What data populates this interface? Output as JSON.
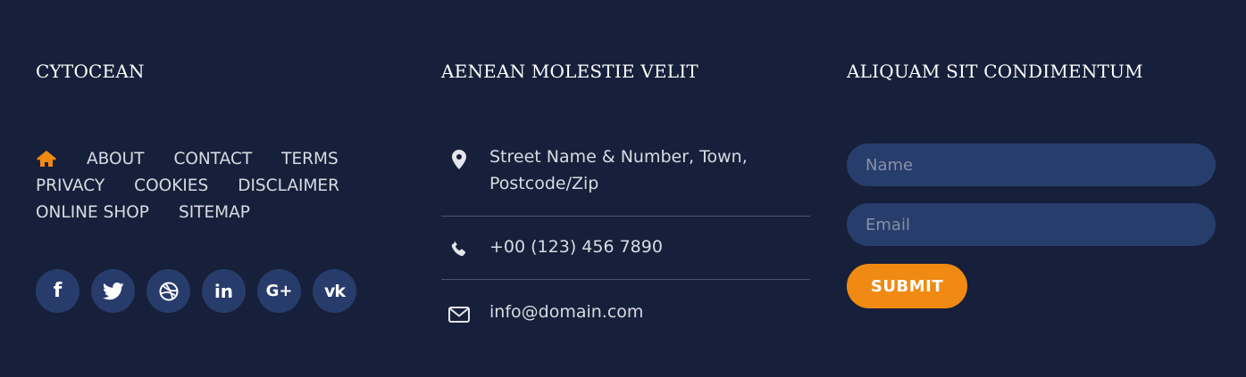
{
  "columns": {
    "brand": {
      "title": "CYTOCEAN"
    },
    "contact": {
      "title": "AENEAN MOLESTIE VELIT"
    },
    "newsletter": {
      "title": "ALIQUAM SIT CONDIMENTUM"
    }
  },
  "nav": {
    "home_icon": "home-icon",
    "links": [
      "ABOUT",
      "CONTACT",
      "TERMS",
      "PRIVACY",
      "COOKIES",
      "DISCLAIMER",
      "ONLINE SHOP",
      "SITEMAP"
    ]
  },
  "social": {
    "icons": [
      "facebook-icon",
      "twitter-icon",
      "dribbble-icon",
      "linkedin-icon",
      "google-plus-icon",
      "vk-icon"
    ],
    "labels": {
      "facebook": "f",
      "linkedin": "in",
      "google": "G+",
      "vk": "vk"
    }
  },
  "contact": {
    "address_line1": "Street Name & Number, Town,",
    "address_line2": "Postcode/Zip",
    "phone": "+00 (123) 456 7890",
    "email": "info@domain.com"
  },
  "form": {
    "name_placeholder": "Name",
    "email_placeholder": "Email",
    "submit_label": "SUBMIT"
  },
  "colors": {
    "background": "#16203a",
    "accent": "#f08a12",
    "field_bg": "#273d6b",
    "social_bg": "#283c6c",
    "divider": "#4a5470"
  }
}
